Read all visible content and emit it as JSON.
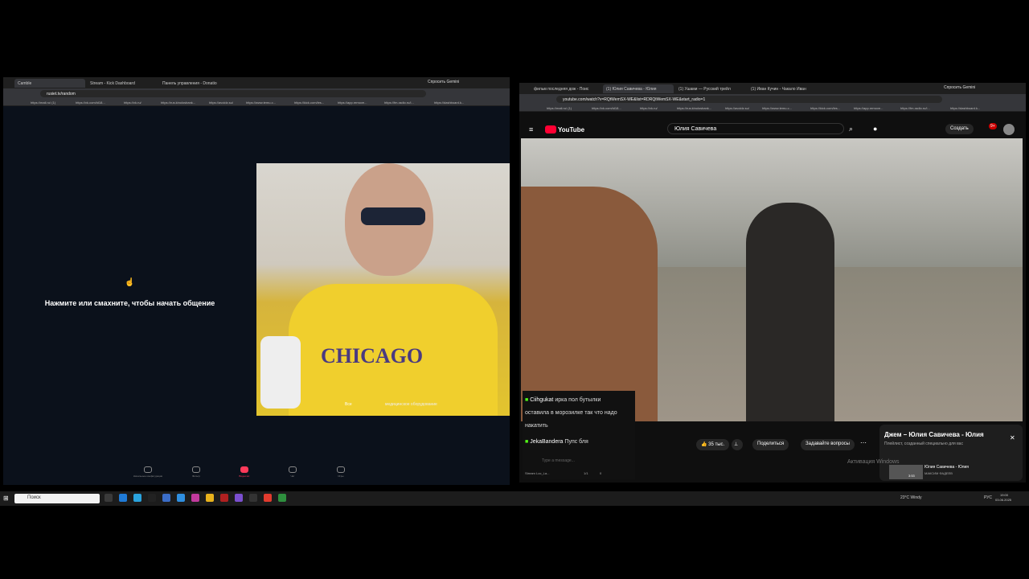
{
  "left_browser": {
    "tabs": [
      {
        "label": "Camble"
      },
      {
        "label": "Stream - Kick Dashboard"
      },
      {
        "label": "Панель управления - Donatio"
      }
    ],
    "address": "rusiet.tv/random",
    "gemini": "Спросить Gemini",
    "bookmarks": [
      "https://mail.ru/ (1)",
      "https://vk.com/id18...",
      "https://vk.ru/",
      "https://rus.kinolosbank...",
      "https://avoidz.su/",
      "https://www.temu.c...",
      "https://kick.com/les...",
      "https://app.remove...",
      "https://fm-radio.ru/i...",
      "https://dashboard.k..."
    ]
  },
  "chat_prompt": "Нажмите или смахните, чтобы начать общение",
  "cam_overlay": "Все",
  "cam_overlay2": "медицинское оборудование",
  "bottom_nav": [
    "Начальные конфигурации",
    "Фильтр",
    "Видеочат",
    "Чат",
    "Игры"
  ],
  "right_browser": {
    "tabs": [
      {
        "label": "фильм последняя дож - Поис"
      },
      {
        "label": "(1) Юлия Савичева - Юлия"
      },
      {
        "label": "(1) Ушами — Русский трейл"
      },
      {
        "label": "(1) Иван Кучин - Чакало Иван"
      }
    ],
    "address": "youtube.com/watch?v=RQtWemSX-WE&list=RDRQtWemSX-WE&start_radio=1",
    "gemini": "Спросить Gemini",
    "bookmarks": [
      "https://mail.ru/ (1)",
      "https://vk.com/id18...",
      "https://vk.ru/",
      "https://rus.kinolosbank...",
      "https://avoidz.su/",
      "https://www.temu.c...",
      "https://kick.com/les...",
      "https://app.remove...",
      "https://fm-radio.ru/i...",
      "https://dashboard.k..."
    ]
  },
  "youtube": {
    "search_value": "Юлия Савичева",
    "create": "Создать",
    "notif_count": "9+",
    "likes": "35 тыс.",
    "share": "Поделиться",
    "ask": "Задавайте вопросы",
    "mix_title": "Джем – Юлия Савичева - Юлия",
    "mix_sub": "Плейлист, созданный специально для вас",
    "next_title": "Юлия Савичева - Юлия",
    "next_sub": "МАКСИМ ФАДЕЕВ",
    "next_duration": "3:53",
    "activation": "Активация Windows"
  },
  "chat": {
    "lines": [
      {
        "user": "Ciihgukat",
        "text": "ирка пол бутылки"
      },
      {
        "user": "",
        "text": "оставила в морозилке так что надо"
      },
      {
        "user": "",
        "text": "накатить"
      },
      {
        "user": "JekaBandera",
        "text": "Пупс бля"
      }
    ],
    "input_placeholder": "Type a message...",
    "footer": "Stream Loc_La...",
    "counts": "1/1",
    "viewers": "0"
  },
  "taskbar": {
    "search": "Поиск",
    "weather": "23°C Windy",
    "lang": "РУС",
    "time": "19:00",
    "date": "03.06.2025"
  },
  "colors": {
    "accent_red": "#ff0033",
    "kick_green": "#53fc18"
  }
}
